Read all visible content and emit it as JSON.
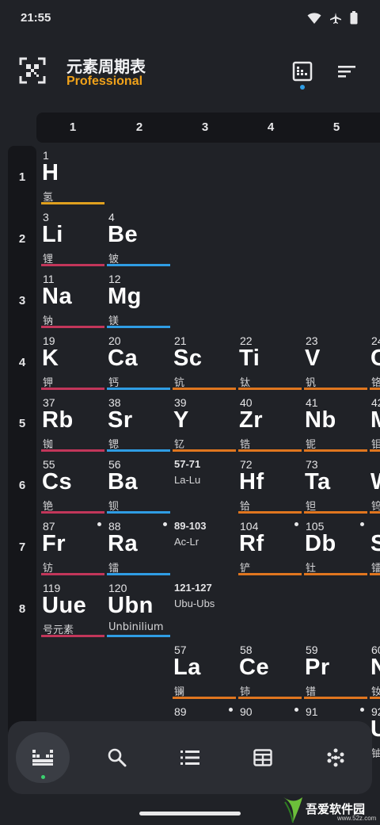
{
  "status": {
    "time": "21:55"
  },
  "app": {
    "title": "元素周期表",
    "subtitle": "Professional"
  },
  "groups": [
    "1",
    "2",
    "3",
    "4",
    "5"
  ],
  "periods": [
    "1",
    "2",
    "3",
    "4",
    "5",
    "6",
    "7",
    "8"
  ],
  "colors": {
    "alkali": "#c2365a",
    "alkaline": "#2f9de4",
    "transition": "#e0761f",
    "hydrogen": "#e0a01f",
    "lanthanide": "#e0761f",
    "accent": "#f0a21a"
  },
  "elements": [
    {
      "num": "1",
      "sym": "H",
      "name": "氢",
      "cat": "hydrogen"
    },
    {
      "num": "3",
      "sym": "Li",
      "name": "锂",
      "cat": "alkali"
    },
    {
      "num": "4",
      "sym": "Be",
      "name": "铍",
      "cat": "alkaline"
    },
    {
      "num": "11",
      "sym": "Na",
      "name": "钠",
      "cat": "alkali"
    },
    {
      "num": "12",
      "sym": "Mg",
      "name": "镁",
      "cat": "alkaline"
    },
    {
      "num": "19",
      "sym": "K",
      "name": "钾",
      "cat": "alkali"
    },
    {
      "num": "20",
      "sym": "Ca",
      "name": "钙",
      "cat": "alkaline"
    },
    {
      "num": "21",
      "sym": "Sc",
      "name": "钪",
      "cat": "transition"
    },
    {
      "num": "22",
      "sym": "Ti",
      "name": "钛",
      "cat": "transition"
    },
    {
      "num": "23",
      "sym": "V",
      "name": "钒",
      "cat": "transition"
    },
    {
      "num": "37",
      "sym": "Rb",
      "name": "铷",
      "cat": "alkali"
    },
    {
      "num": "38",
      "sym": "Sr",
      "name": "锶",
      "cat": "alkaline"
    },
    {
      "num": "39",
      "sym": "Y",
      "name": "钇",
      "cat": "transition"
    },
    {
      "num": "40",
      "sym": "Zr",
      "name": "锆",
      "cat": "transition"
    },
    {
      "num": "41",
      "sym": "Nb",
      "name": "铌",
      "cat": "transition"
    },
    {
      "num": "55",
      "sym": "Cs",
      "name": "铯",
      "cat": "alkali"
    },
    {
      "num": "56",
      "sym": "Ba",
      "name": "钡",
      "cat": "alkaline"
    },
    {
      "num": "57-71",
      "sym": "",
      "name": "La-Lu",
      "cat": "range"
    },
    {
      "num": "72",
      "sym": "Hf",
      "name": "铪",
      "cat": "transition"
    },
    {
      "num": "73",
      "sym": "Ta",
      "name": "钽",
      "cat": "transition"
    },
    {
      "num": "87",
      "sym": "Fr",
      "name": "钫",
      "cat": "alkali",
      "radio": true
    },
    {
      "num": "88",
      "sym": "Ra",
      "name": "镭",
      "cat": "alkaline",
      "radio": true
    },
    {
      "num": "89-103",
      "sym": "",
      "name": "Ac-Lr",
      "cat": "range"
    },
    {
      "num": "104",
      "sym": "Rf",
      "name": "铲",
      "cat": "transition",
      "radio": true
    },
    {
      "num": "105",
      "sym": "Db",
      "name": "钍",
      "cat": "transition",
      "radio": true
    },
    {
      "num": "119",
      "sym": "Uue",
      "name": "号元素",
      "cat": "alkali"
    },
    {
      "num": "120",
      "sym": "Ubn",
      "name": "Unbinilium",
      "cat": "alkaline"
    },
    {
      "num": "121-127",
      "sym": "",
      "name": "Ubu-Ubs",
      "cat": "range"
    },
    {
      "num": "57",
      "sym": "La",
      "name": "镧",
      "cat": "lanthanide"
    },
    {
      "num": "58",
      "sym": "Ce",
      "name": "铈",
      "cat": "lanthanide"
    },
    {
      "num": "59",
      "sym": "Pr",
      "name": "镨",
      "cat": "lanthanide"
    },
    {
      "num": "89",
      "sym": "",
      "name": "",
      "cat": "actinide",
      "radio": true
    },
    {
      "num": "90",
      "sym": "",
      "name": "",
      "cat": "actinide",
      "radio": true
    },
    {
      "num": "91",
      "sym": "",
      "name": "",
      "cat": "actinide",
      "radio": true
    }
  ],
  "partial_column": [
    {
      "num": "24",
      "sym": "C",
      "name": "铬"
    },
    {
      "num": "42",
      "sym": "M",
      "name": "钼"
    },
    {
      "num": "",
      "sym": "W",
      "name": "钨"
    },
    {
      "num": "",
      "sym": "S",
      "name": "镭"
    },
    {
      "num": "60",
      "sym": "N",
      "name": "钕"
    },
    {
      "num": "92",
      "sym": "U",
      "name": "铀"
    }
  ],
  "nav": {
    "items": [
      "table-icon",
      "search-icon",
      "list-icon",
      "grid-icon",
      "dots-icon"
    ]
  },
  "watermark": {
    "text": "吾爱软件园",
    "sub": "www.52z.com"
  }
}
